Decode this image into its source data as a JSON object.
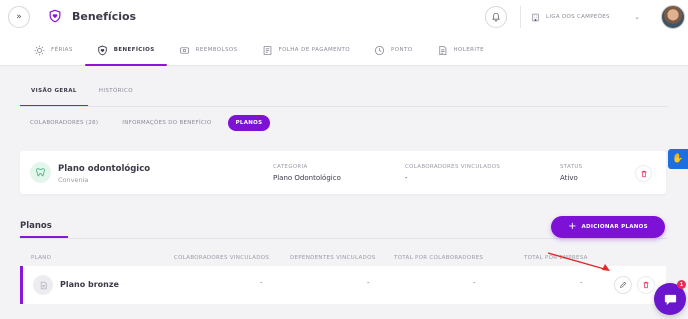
{
  "header": {
    "title": "Benefícios",
    "company": "LIGA DOS CAMPEÕES"
  },
  "module_tabs": [
    {
      "label": "FÉRIAS",
      "icon": "sun-icon"
    },
    {
      "label": "BENEFÍCIOS",
      "icon": "heart-shield-icon",
      "active": true
    },
    {
      "label": "REEMBOLSOS",
      "icon": "refund-icon"
    },
    {
      "label": "FOLHA DE PAGAMENTO",
      "icon": "document-icon"
    },
    {
      "label": "PONTO",
      "icon": "clock-icon"
    },
    {
      "label": "HOLERITE",
      "icon": "payslip-icon"
    }
  ],
  "sub_tabs": [
    {
      "label": "VISÃO GERAL",
      "active": true
    },
    {
      "label": "HISTÓRICO"
    }
  ],
  "pill_tabs": [
    {
      "label": "COLABORADORES (28)"
    },
    {
      "label": "INFORMAÇÕES DO BENEFÍCIO"
    },
    {
      "label": "PLANOS",
      "active": true
    }
  ],
  "benefit": {
    "name": "Plano odontológico",
    "provider": "Convenia",
    "category_label": "CATEGORIA",
    "category_value": "Plano Odontológico",
    "linked_label": "COLABORADORES VINCULADOS",
    "linked_value": "-",
    "status_label": "STATUS",
    "status_value": "Ativo"
  },
  "plans": {
    "title": "Planos",
    "add_label": "ADICIONAR PLANOS",
    "columns": [
      "PLANO",
      "COLABORADORES VINCULADOS",
      "DEPENDENTES VINCULADOS",
      "TOTAL POR COLABORADORES",
      "TOTAL POR EMPRESA"
    ],
    "rows": [
      {
        "name": "Plano bronze",
        "collaborators": "-",
        "dependents": "-",
        "total_collab": "-",
        "total_company": "-"
      }
    ]
  },
  "chat": {
    "badge": "1"
  },
  "colors": {
    "accent": "#7d12d6",
    "active_status": "#3a3a48",
    "translate": "#1d6fe0",
    "badge": "#ef2b54"
  }
}
